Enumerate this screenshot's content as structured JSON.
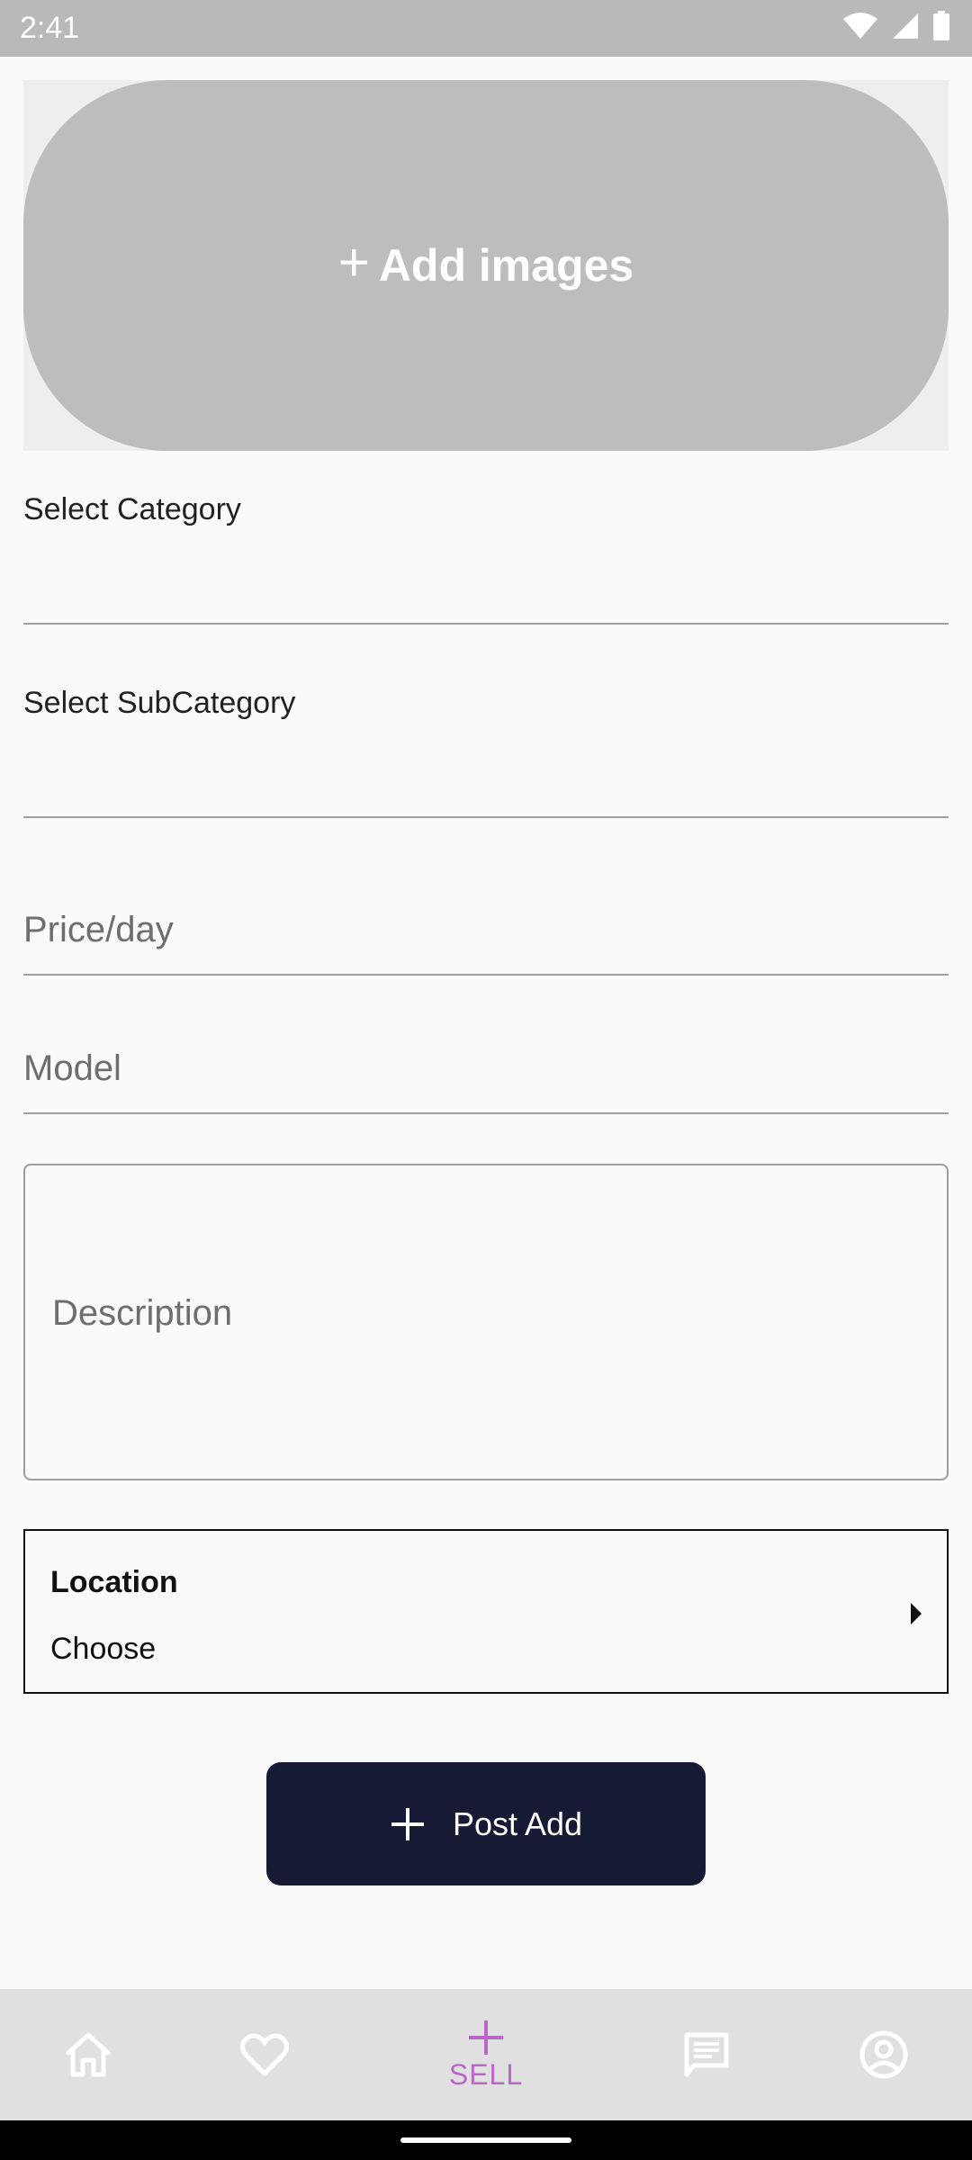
{
  "status_bar": {
    "time": "2:41"
  },
  "image_picker": {
    "plus": "+",
    "label": "Add images"
  },
  "category_field": {
    "label": "Select Category"
  },
  "subcategory_field": {
    "label": "Select SubCategory"
  },
  "price_input": {
    "placeholder": "Price/day",
    "value": ""
  },
  "model_input": {
    "placeholder": "Model",
    "value": ""
  },
  "description_input": {
    "placeholder": "Description",
    "value": ""
  },
  "location": {
    "title": "Location",
    "value": "Choose"
  },
  "post_button": {
    "label": "Post Add"
  },
  "bottom_nav": {
    "items": [
      {
        "icon": "home-icon"
      },
      {
        "icon": "heart-icon"
      },
      {
        "icon": "plus-icon",
        "label": "SELL",
        "active": true
      },
      {
        "icon": "chat-icon"
      },
      {
        "icon": "account-circle-icon"
      }
    ]
  },
  "colors": {
    "accent": "#BA68C8",
    "button_bg": "#161A35",
    "image_placeholder": "#BDBDBD",
    "nav_bg": "#E0E0E0"
  }
}
